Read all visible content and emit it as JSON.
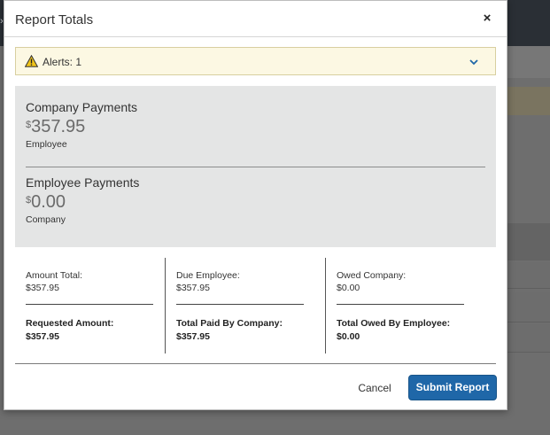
{
  "background": {
    "left_glyph": "›"
  },
  "modal": {
    "title": "Report Totals",
    "close_label": "×"
  },
  "alert": {
    "text": "Alerts: 1",
    "icon": "warning-triangle-icon",
    "icon_color": "#f0c419",
    "chevron_icon": "chevron-down-icon",
    "chevron_color": "#1f67a8"
  },
  "payments": [
    {
      "title": "Company Payments",
      "currency": "$",
      "amount": "357.95",
      "subtitle": "Employee"
    },
    {
      "title": "Employee Payments",
      "currency": "$",
      "amount": "0.00",
      "subtitle": "Company"
    }
  ],
  "totals": [
    {
      "label": "Amount Total:",
      "value": "$357.95",
      "label2": "Requested Amount:",
      "value2": "$357.95"
    },
    {
      "label": "Due Employee:",
      "value": "$357.95",
      "label2": "Total Paid By Company:",
      "value2": "$357.95"
    },
    {
      "label": "Owed Company:",
      "value": "$0.00",
      "label2": "Total Owed By Employee:",
      "value2": "$0.00"
    }
  ],
  "footer": {
    "cancel_label": "Cancel",
    "submit_label": "Submit Report",
    "submit_color": "#1f67a8"
  }
}
